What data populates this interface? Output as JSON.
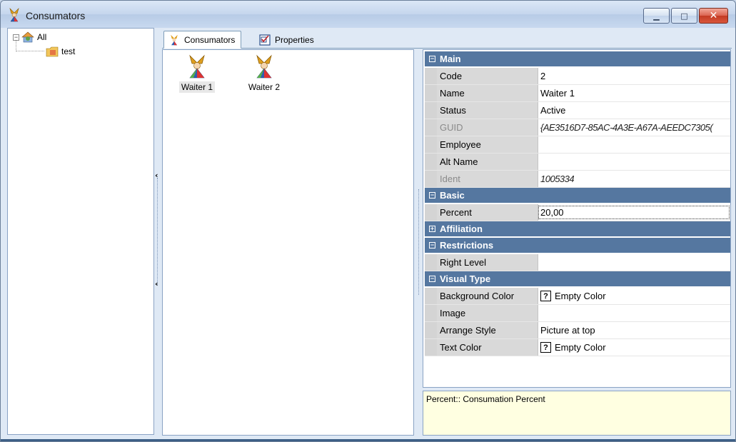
{
  "window": {
    "title": "Consumators"
  },
  "tree": {
    "root_label": "All",
    "child_label": "test"
  },
  "tabs": [
    {
      "label": "Consumators",
      "icon": "consumator-icon",
      "active": true
    },
    {
      "label": "Properties",
      "icon": "properties-icon",
      "active": false
    }
  ],
  "consumators": [
    {
      "label": "Waiter 1",
      "selected": true
    },
    {
      "label": "Waiter 2",
      "selected": false
    }
  ],
  "property_grid": {
    "categories": [
      {
        "name": "Main",
        "expanded": true,
        "props": [
          {
            "name": "Code",
            "value": "2"
          },
          {
            "name": "Name",
            "value": "Waiter 1"
          },
          {
            "name": "Status",
            "value": "Active"
          },
          {
            "name": "GUID",
            "value": "{AE3516D7-85AC-4A3E-A67A-AEEDC7305(",
            "readonly": true
          },
          {
            "name": "Employee",
            "value": ""
          },
          {
            "name": "Alt Name",
            "value": ""
          },
          {
            "name": "Ident",
            "value": "1005334",
            "readonly": true
          }
        ]
      },
      {
        "name": "Basic",
        "expanded": true,
        "props": [
          {
            "name": "Percent",
            "value": "20,00",
            "editing": true
          }
        ]
      },
      {
        "name": "Affiliation",
        "expanded": false,
        "props": []
      },
      {
        "name": "Restrictions",
        "expanded": true,
        "props": [
          {
            "name": "Right Level",
            "value": ""
          }
        ]
      },
      {
        "name": "Visual Type",
        "expanded": true,
        "props": [
          {
            "name": "Background Color",
            "value": "Empty Color",
            "color_box": "?"
          },
          {
            "name": "Image",
            "value": ""
          },
          {
            "name": "Arrange Style",
            "value": "Picture at top"
          },
          {
            "name": "Text Color",
            "value": "Empty Color",
            "color_box": "?"
          }
        ]
      }
    ]
  },
  "description": {
    "text": "Percent:: Consumation Percent"
  },
  "colors": {
    "category_bar": "#5577a0",
    "description_bg": "#ffffe1",
    "close_button": "#c33a24"
  }
}
